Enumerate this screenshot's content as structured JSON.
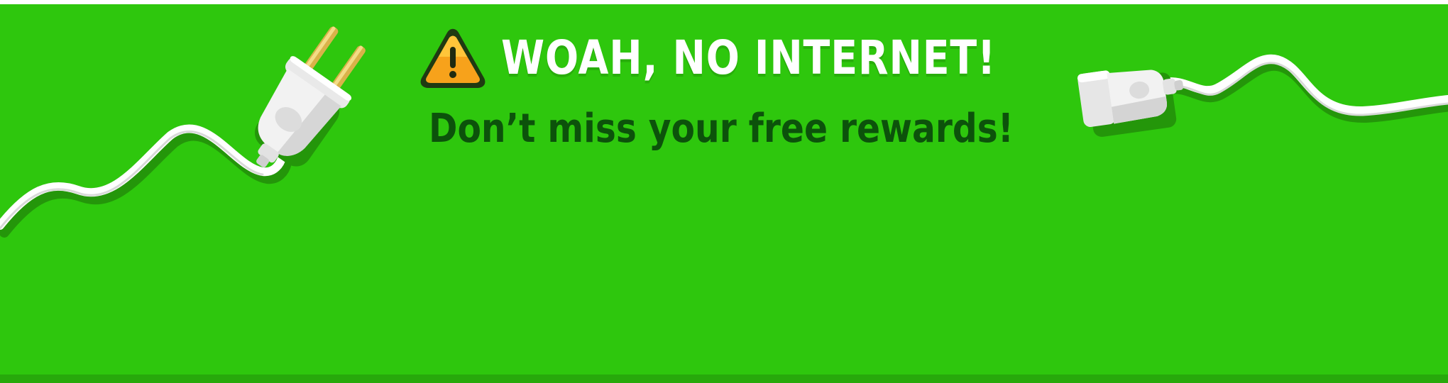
{
  "banner": {
    "headline": "WOAH, NO INTERNET!",
    "subheadline": "Don’t miss your free rewards!",
    "icons": {
      "warning": "warning-triangle-icon",
      "plug": "electric-plug-icon",
      "socket": "extension-socket-icon"
    },
    "colors": {
      "background": "#2ec70d",
      "headline": "#ffffff",
      "subheadline": "#0c520b",
      "warning_fill": "#f7a21b",
      "warning_outline": "#1f3a12"
    }
  }
}
